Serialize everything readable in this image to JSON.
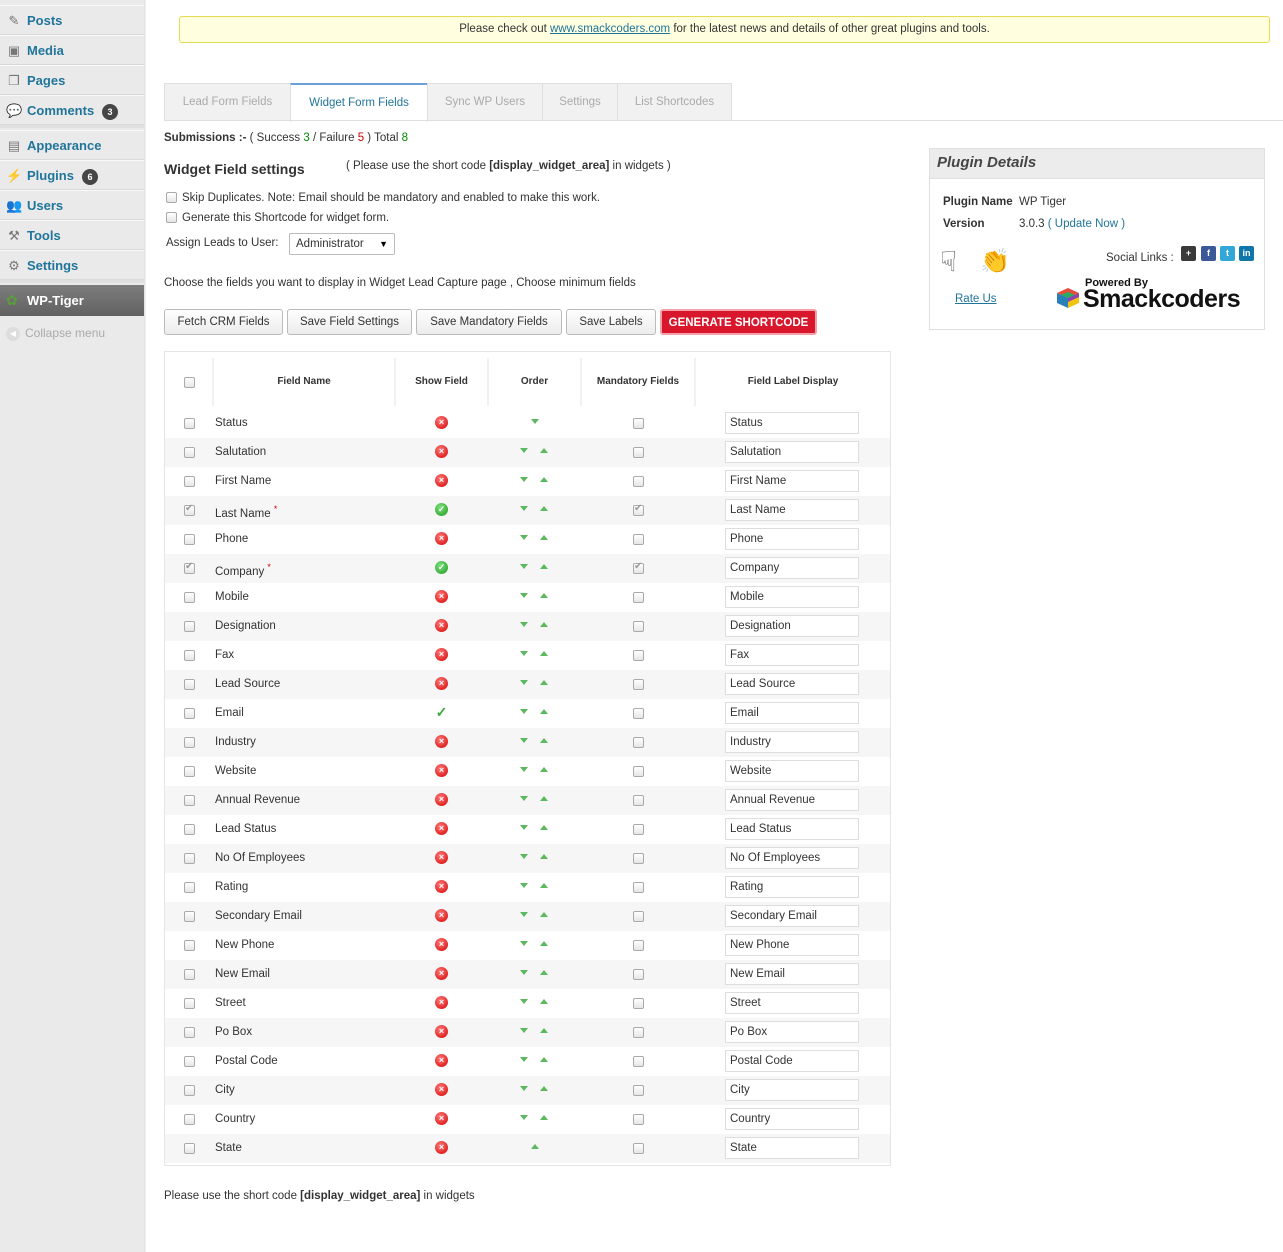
{
  "sidebar": {
    "items": [
      {
        "label": "Posts",
        "icon": "posts-icon",
        "glyph": "✎"
      },
      {
        "label": "Media",
        "icon": "media-icon",
        "glyph": "▣"
      },
      {
        "label": "Pages",
        "icon": "pages-icon",
        "glyph": "❐"
      },
      {
        "label": "Comments",
        "icon": "comments-icon",
        "glyph": "💬",
        "badge": "3"
      },
      {
        "label": "Appearance",
        "icon": "appearance-icon",
        "glyph": "▤"
      },
      {
        "label": "Plugins",
        "icon": "plugins-icon",
        "glyph": "⚡",
        "badge": "6"
      },
      {
        "label": "Users",
        "icon": "users-icon",
        "glyph": "👥"
      },
      {
        "label": "Tools",
        "icon": "tools-icon",
        "glyph": "⚒"
      },
      {
        "label": "Settings",
        "icon": "settings-icon",
        "glyph": "⚙"
      }
    ],
    "active": {
      "label": "WP-Tiger",
      "icon": "wp-tiger-icon"
    },
    "collapse": "Collapse menu"
  },
  "notice": {
    "before": "Please check out ",
    "link": "www.smackcoders.com",
    "after": " for the latest news and details of other great plugins and tools."
  },
  "tabs": [
    "Lead Form Fields",
    "Widget Form Fields",
    "Sync WP Users",
    "Settings",
    "List Shortcodes"
  ],
  "active_tab": "Widget Form Fields",
  "submissions": {
    "label": "Submissions :-",
    "success_label": "Success",
    "success": "3",
    "failure_label": "Failure",
    "failure": "5",
    "total_label": "Total",
    "total": "8"
  },
  "section": {
    "title": "Widget Field settings",
    "note_before": "( Please use the short code ",
    "shortcode": "[display_widget_area]",
    "note_after": " in widgets )",
    "skip_duplicates": "Skip Duplicates. Note: Email should be mandatory and enabled to make this work.",
    "generate_shortcode_opt": "Generate this Shortcode for widget form.",
    "assign_label": "Assign Leads to User:",
    "assign_value": "Administrator",
    "choose_text": "Choose the fields you want to display in Widget Lead Capture page , Choose minimum fields"
  },
  "buttons": {
    "fetch": "Fetch CRM Fields",
    "save_settings": "Save Field Settings",
    "save_mandatory": "Save Mandatory Fields",
    "save_labels": "Save Labels",
    "generate": "GENERATE SHORTCODE"
  },
  "table": {
    "headers": [
      "Field Name",
      "Show Field",
      "Order",
      "Mandatory Fields",
      "Field Label Display"
    ],
    "rows": [
      {
        "name": "Status",
        "show": "x",
        "order": "down",
        "checked": false,
        "required": false,
        "label": "Status"
      },
      {
        "name": "Salutation",
        "show": "x",
        "order": "both",
        "checked": false,
        "required": false,
        "label": "Salutation"
      },
      {
        "name": "First Name",
        "show": "x",
        "order": "both",
        "checked": false,
        "required": false,
        "label": "First Name"
      },
      {
        "name": "Last Name",
        "show": "ok",
        "order": "both",
        "checked": true,
        "required": true,
        "label": "Last Name"
      },
      {
        "name": "Phone",
        "show": "x",
        "order": "both",
        "checked": false,
        "required": false,
        "label": "Phone"
      },
      {
        "name": "Company",
        "show": "ok",
        "order": "both",
        "checked": true,
        "required": true,
        "label": "Company"
      },
      {
        "name": "Mobile",
        "show": "x",
        "order": "both",
        "checked": false,
        "required": false,
        "label": "Mobile"
      },
      {
        "name": "Designation",
        "show": "x",
        "order": "both",
        "checked": false,
        "required": false,
        "label": "Designation"
      },
      {
        "name": "Fax",
        "show": "x",
        "order": "both",
        "checked": false,
        "required": false,
        "label": "Fax"
      },
      {
        "name": "Lead Source",
        "show": "x",
        "order": "both",
        "checked": false,
        "required": false,
        "label": "Lead Source"
      },
      {
        "name": "Email",
        "show": "tick",
        "order": "both",
        "checked": false,
        "required": false,
        "label": "Email"
      },
      {
        "name": "Industry",
        "show": "x",
        "order": "both",
        "checked": false,
        "required": false,
        "label": "Industry"
      },
      {
        "name": "Website",
        "show": "x",
        "order": "both",
        "checked": false,
        "required": false,
        "label": "Website"
      },
      {
        "name": "Annual Revenue",
        "show": "x",
        "order": "both",
        "checked": false,
        "required": false,
        "label": "Annual Revenue"
      },
      {
        "name": "Lead Status",
        "show": "x",
        "order": "both",
        "checked": false,
        "required": false,
        "label": "Lead Status"
      },
      {
        "name": "No Of Employees",
        "show": "x",
        "order": "both",
        "checked": false,
        "required": false,
        "label": "No Of Employees"
      },
      {
        "name": "Rating",
        "show": "x",
        "order": "both",
        "checked": false,
        "required": false,
        "label": "Rating"
      },
      {
        "name": "Secondary Email",
        "show": "x",
        "order": "both",
        "checked": false,
        "required": false,
        "label": "Secondary Email"
      },
      {
        "name": "New Phone",
        "show": "x",
        "order": "both",
        "checked": false,
        "required": false,
        "label": "New Phone"
      },
      {
        "name": "New Email",
        "show": "x",
        "order": "both",
        "checked": false,
        "required": false,
        "label": "New Email"
      },
      {
        "name": "Street",
        "show": "x",
        "order": "both",
        "checked": false,
        "required": false,
        "label": "Street"
      },
      {
        "name": "Po Box",
        "show": "x",
        "order": "both",
        "checked": false,
        "required": false,
        "label": "Po Box"
      },
      {
        "name": "Postal Code",
        "show": "x",
        "order": "both",
        "checked": false,
        "required": false,
        "label": "Postal Code"
      },
      {
        "name": "City",
        "show": "x",
        "order": "both",
        "checked": false,
        "required": false,
        "label": "City"
      },
      {
        "name": "Country",
        "show": "x",
        "order": "both",
        "checked": false,
        "required": false,
        "label": "Country"
      },
      {
        "name": "State",
        "show": "x",
        "order": "up",
        "checked": false,
        "required": false,
        "label": "State"
      }
    ]
  },
  "footer": {
    "before": "Please use the short code ",
    "shortcode": "[display_widget_area]",
    "after": " in widgets"
  },
  "plugin_details": {
    "title": "Plugin Details",
    "name_label": "Plugin Name",
    "name": "WP Tiger",
    "version_label": "Version",
    "version": "3.0.3",
    "update": "( Update Now )",
    "social_label": "Social Links :",
    "social_icons": [
      "google-plus-icon",
      "facebook-icon",
      "twitter-icon",
      "linkedin-icon"
    ],
    "rate_us": "Rate Us",
    "logo_powered": "Powered By",
    "logo_name": "Smackcoders"
  },
  "colors": {
    "link": "#21759b",
    "generate_button": "#d9172c",
    "notice_bg": "#ffffe0",
    "success": "#008800",
    "failure": "#cc0000"
  }
}
